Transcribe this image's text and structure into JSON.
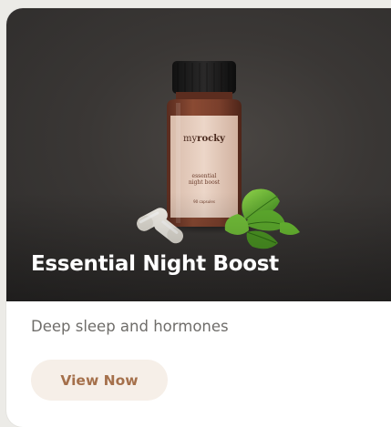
{
  "product": {
    "title": "Essential Night Boost",
    "description": "Deep sleep and hormones",
    "cta_label": "View Now",
    "label": {
      "brand_prefix": "my",
      "brand_main": "rocky",
      "line1": "essential",
      "line2": "night boost",
      "count": "90 capsules"
    }
  },
  "colors": {
    "hero_bg": "#3a3735",
    "title_text": "#ffffff",
    "description_text": "#6f6d6a",
    "button_bg": "#f6efe8",
    "button_text": "#a5704b",
    "bottle": "#7a3f2c",
    "label": "#e8cfc1",
    "cap": "#1c1b1b"
  },
  "icons": {
    "capsules": "capsule-pills-icon",
    "leaves": "green-tea-leaves-icon"
  }
}
